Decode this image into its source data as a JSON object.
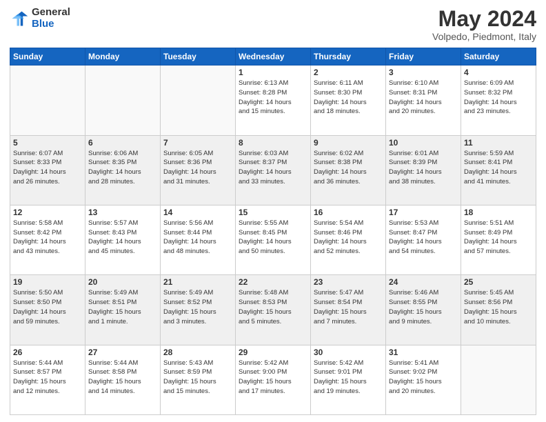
{
  "logo": {
    "general": "General",
    "blue": "Blue"
  },
  "header": {
    "month": "May 2024",
    "location": "Volpedo, Piedmont, Italy"
  },
  "weekdays": [
    "Sunday",
    "Monday",
    "Tuesday",
    "Wednesday",
    "Thursday",
    "Friday",
    "Saturday"
  ],
  "weeks": [
    [
      {
        "day": "",
        "info": ""
      },
      {
        "day": "",
        "info": ""
      },
      {
        "day": "",
        "info": ""
      },
      {
        "day": "1",
        "info": "Sunrise: 6:13 AM\nSunset: 8:28 PM\nDaylight: 14 hours\nand 15 minutes."
      },
      {
        "day": "2",
        "info": "Sunrise: 6:11 AM\nSunset: 8:30 PM\nDaylight: 14 hours\nand 18 minutes."
      },
      {
        "day": "3",
        "info": "Sunrise: 6:10 AM\nSunset: 8:31 PM\nDaylight: 14 hours\nand 20 minutes."
      },
      {
        "day": "4",
        "info": "Sunrise: 6:09 AM\nSunset: 8:32 PM\nDaylight: 14 hours\nand 23 minutes."
      }
    ],
    [
      {
        "day": "5",
        "info": "Sunrise: 6:07 AM\nSunset: 8:33 PM\nDaylight: 14 hours\nand 26 minutes."
      },
      {
        "day": "6",
        "info": "Sunrise: 6:06 AM\nSunset: 8:35 PM\nDaylight: 14 hours\nand 28 minutes."
      },
      {
        "day": "7",
        "info": "Sunrise: 6:05 AM\nSunset: 8:36 PM\nDaylight: 14 hours\nand 31 minutes."
      },
      {
        "day": "8",
        "info": "Sunrise: 6:03 AM\nSunset: 8:37 PM\nDaylight: 14 hours\nand 33 minutes."
      },
      {
        "day": "9",
        "info": "Sunrise: 6:02 AM\nSunset: 8:38 PM\nDaylight: 14 hours\nand 36 minutes."
      },
      {
        "day": "10",
        "info": "Sunrise: 6:01 AM\nSunset: 8:39 PM\nDaylight: 14 hours\nand 38 minutes."
      },
      {
        "day": "11",
        "info": "Sunrise: 5:59 AM\nSunset: 8:41 PM\nDaylight: 14 hours\nand 41 minutes."
      }
    ],
    [
      {
        "day": "12",
        "info": "Sunrise: 5:58 AM\nSunset: 8:42 PM\nDaylight: 14 hours\nand 43 minutes."
      },
      {
        "day": "13",
        "info": "Sunrise: 5:57 AM\nSunset: 8:43 PM\nDaylight: 14 hours\nand 45 minutes."
      },
      {
        "day": "14",
        "info": "Sunrise: 5:56 AM\nSunset: 8:44 PM\nDaylight: 14 hours\nand 48 minutes."
      },
      {
        "day": "15",
        "info": "Sunrise: 5:55 AM\nSunset: 8:45 PM\nDaylight: 14 hours\nand 50 minutes."
      },
      {
        "day": "16",
        "info": "Sunrise: 5:54 AM\nSunset: 8:46 PM\nDaylight: 14 hours\nand 52 minutes."
      },
      {
        "day": "17",
        "info": "Sunrise: 5:53 AM\nSunset: 8:47 PM\nDaylight: 14 hours\nand 54 minutes."
      },
      {
        "day": "18",
        "info": "Sunrise: 5:51 AM\nSunset: 8:49 PM\nDaylight: 14 hours\nand 57 minutes."
      }
    ],
    [
      {
        "day": "19",
        "info": "Sunrise: 5:50 AM\nSunset: 8:50 PM\nDaylight: 14 hours\nand 59 minutes."
      },
      {
        "day": "20",
        "info": "Sunrise: 5:49 AM\nSunset: 8:51 PM\nDaylight: 15 hours\nand 1 minute."
      },
      {
        "day": "21",
        "info": "Sunrise: 5:49 AM\nSunset: 8:52 PM\nDaylight: 15 hours\nand 3 minutes."
      },
      {
        "day": "22",
        "info": "Sunrise: 5:48 AM\nSunset: 8:53 PM\nDaylight: 15 hours\nand 5 minutes."
      },
      {
        "day": "23",
        "info": "Sunrise: 5:47 AM\nSunset: 8:54 PM\nDaylight: 15 hours\nand 7 minutes."
      },
      {
        "day": "24",
        "info": "Sunrise: 5:46 AM\nSunset: 8:55 PM\nDaylight: 15 hours\nand 9 minutes."
      },
      {
        "day": "25",
        "info": "Sunrise: 5:45 AM\nSunset: 8:56 PM\nDaylight: 15 hours\nand 10 minutes."
      }
    ],
    [
      {
        "day": "26",
        "info": "Sunrise: 5:44 AM\nSunset: 8:57 PM\nDaylight: 15 hours\nand 12 minutes."
      },
      {
        "day": "27",
        "info": "Sunrise: 5:44 AM\nSunset: 8:58 PM\nDaylight: 15 hours\nand 14 minutes."
      },
      {
        "day": "28",
        "info": "Sunrise: 5:43 AM\nSunset: 8:59 PM\nDaylight: 15 hours\nand 15 minutes."
      },
      {
        "day": "29",
        "info": "Sunrise: 5:42 AM\nSunset: 9:00 PM\nDaylight: 15 hours\nand 17 minutes."
      },
      {
        "day": "30",
        "info": "Sunrise: 5:42 AM\nSunset: 9:01 PM\nDaylight: 15 hours\nand 19 minutes."
      },
      {
        "day": "31",
        "info": "Sunrise: 5:41 AM\nSunset: 9:02 PM\nDaylight: 15 hours\nand 20 minutes."
      },
      {
        "day": "",
        "info": ""
      }
    ]
  ]
}
